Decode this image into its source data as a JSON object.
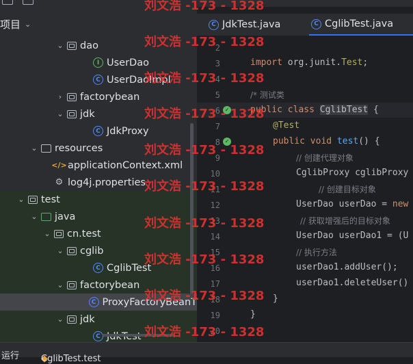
{
  "project_panel": {
    "title": "项目",
    "tree": [
      {
        "label": "dao",
        "icon": "folder-icon",
        "depth": 5,
        "expanded": true
      },
      {
        "label": "UserDao",
        "icon": "interface-icon",
        "depth": 7
      },
      {
        "label": "UserDaoImpl",
        "icon": "class-icon",
        "depth": 7
      },
      {
        "label": "factorybean",
        "icon": "folder-icon",
        "depth": 5,
        "expanded": false
      },
      {
        "label": "jdk",
        "icon": "folder-icon",
        "depth": 5,
        "expanded": true
      },
      {
        "label": "JdkProxy",
        "icon": "class-icon",
        "depth": 7
      },
      {
        "label": "resources",
        "icon": "resources-folder-icon",
        "depth": 3,
        "expanded": true
      },
      {
        "label": "applicationContext.xml",
        "icon": "xml-file-icon",
        "depth": 4
      },
      {
        "label": "log4j.properties",
        "icon": "properties-file-icon",
        "depth": 4
      },
      {
        "label": "test",
        "icon": "folder-icon",
        "depth": 2,
        "expanded": true
      },
      {
        "label": "java",
        "icon": "test-source-folder-icon",
        "depth": 3,
        "expanded": true
      },
      {
        "label": "cn.test",
        "icon": "package-icon",
        "depth": 4,
        "expanded": true
      },
      {
        "label": "cglib",
        "icon": "package-icon",
        "depth": 5,
        "expanded": true
      },
      {
        "label": "CglibTest",
        "icon": "class-icon",
        "depth": 7
      },
      {
        "label": "factorybean",
        "icon": "package-icon",
        "depth": 5,
        "expanded": true
      },
      {
        "label": "ProxyFactoryBeanT",
        "icon": "class-icon",
        "depth": 7,
        "selected": true
      },
      {
        "label": "jdk",
        "icon": "package-icon",
        "depth": 5,
        "expanded": true
      },
      {
        "label": "JdkTest",
        "icon": "class-icon",
        "depth": 7
      }
    ]
  },
  "tabs": [
    {
      "label": "JdkTest.java",
      "active": false
    },
    {
      "label": "CglibTest.java",
      "active": true
    }
  ],
  "editor": {
    "line_numbers": [
      "2",
      "3",
      "4",
      "5",
      "6",
      "7",
      "8",
      "9",
      "10",
      "11",
      "12",
      "13",
      "14",
      "15",
      "16",
      "17",
      "18",
      "19",
      "20"
    ],
    "lines": {
      "l3a": "import ",
      "l3b": "org.junit.",
      "l3c": "Test",
      "l3d": ";",
      "l5": "测试类",
      "l6a": "public class ",
      "l6b": "CglibTest",
      "l6c": " {",
      "l7": "@Test",
      "l8a": "public void ",
      "l8b": "test",
      "l8c": "() {",
      "l9": "// 创建代理对象",
      "l10": "CglibProxy cglibProxy",
      "l11": "// 创建目标对象",
      "l12a": "UserDao userDao = ",
      "l12b": "new",
      "l13": "// 获取增强后的目标对象",
      "l14": "UserDao userDao1 = (U",
      "l15": "// 执行方法",
      "l16": "userDao1.addUser();",
      "l17": "userDao1.deleteUser()",
      "l18": "}",
      "l19": "}"
    }
  },
  "bottom_bar": {
    "left": "运行",
    "tab": "CglibTest.test"
  },
  "watermark": "刘文浩 -173 - 1328",
  "colors": {
    "keyword": "#cf8e6d",
    "function": "#56a8f5",
    "annotation": "#b3ae60",
    "comment": "#7a7e85",
    "accent": "#3574f0",
    "watermark": "#e0322f"
  }
}
